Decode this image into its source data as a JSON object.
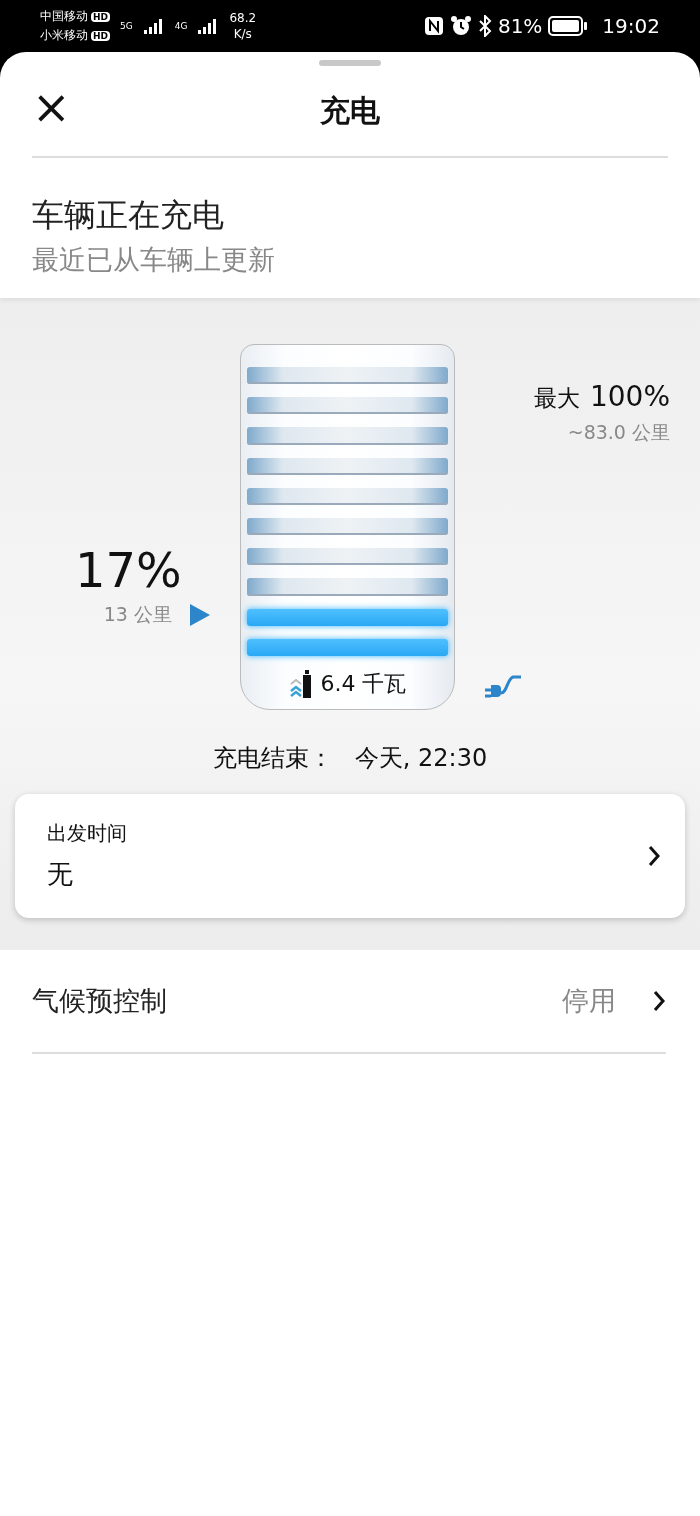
{
  "status_bar": {
    "carrier_1": "中国移动",
    "carrier_2": "小米移动",
    "hd_1": "HD",
    "hd_2": "HD",
    "network_1": "5G",
    "network_2": "4G",
    "speed_value": "68.2",
    "speed_unit": "K/s",
    "battery": "81%",
    "time": "19:02"
  },
  "header": {
    "close": "×",
    "title": "充电"
  },
  "charging_status": {
    "title": "车辆正在充电",
    "subtitle": "最近已从车辆上更新"
  },
  "battery": {
    "current_percent": "17%",
    "current_range": "13 公里",
    "max_label": "最大",
    "max_percent": "100%",
    "max_range": "~83.0 公里",
    "power": "6.4 千瓦",
    "plugged": true,
    "segments": [
      {
        "lit": false
      },
      {
        "lit": false
      },
      {
        "lit": false
      },
      {
        "lit": false
      },
      {
        "lit": false
      },
      {
        "lit": false
      },
      {
        "lit": false
      },
      {
        "lit": false
      },
      {
        "lit": true
      },
      {
        "lit": true
      }
    ],
    "end_label": "充电结束：",
    "end_value": "今天, 22:30"
  },
  "departure": {
    "label": "出发时间",
    "value": "无"
  },
  "climate": {
    "label": "气候预控制",
    "value": "停用"
  }
}
